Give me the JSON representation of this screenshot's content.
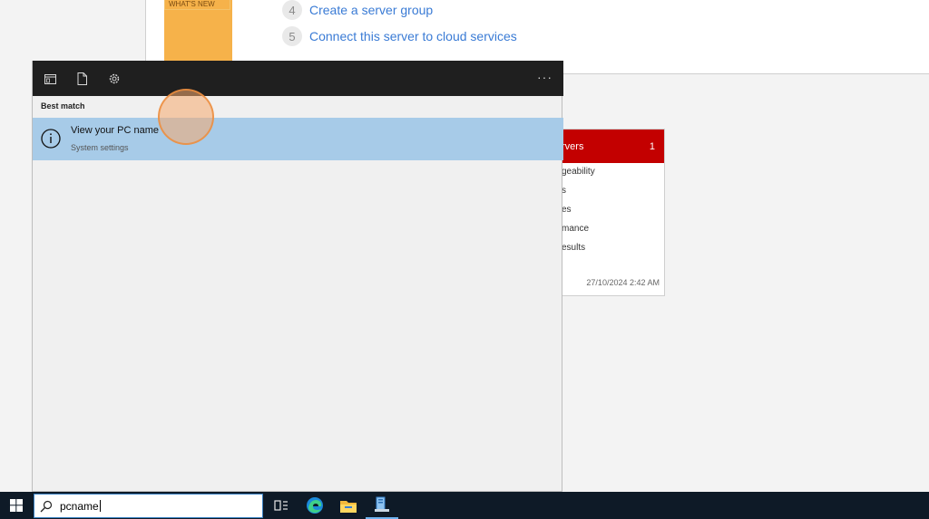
{
  "server_manager": {
    "whats_new_label": "WHAT'S NEW",
    "steps": [
      {
        "num": "4",
        "label": "Create a server group"
      },
      {
        "num": "5",
        "label": "Connect this server to cloud services"
      }
    ],
    "servers_tile": {
      "title": "rvers",
      "count": "1",
      "rows": [
        "geability",
        "s",
        "es",
        "mance",
        "esults"
      ],
      "timestamp": "27/10/2024 2:42 AM",
      "header_color": "#c30000"
    }
  },
  "search_panel": {
    "toolbar_icons": [
      "apps-icon",
      "documents-icon",
      "settings-gear-icon"
    ],
    "more_label": "···",
    "section_label": "Best match",
    "best_match": {
      "title": "View your PC name",
      "subtitle": "System settings",
      "icon": "info-icon",
      "highlight_color": "#a7cbe8"
    }
  },
  "taskbar": {
    "search_value": "pcname",
    "apps": [
      "task-view-icon",
      "edge-icon",
      "file-explorer-icon",
      "server-manager-icon"
    ],
    "background_color": "#0e1a27"
  }
}
